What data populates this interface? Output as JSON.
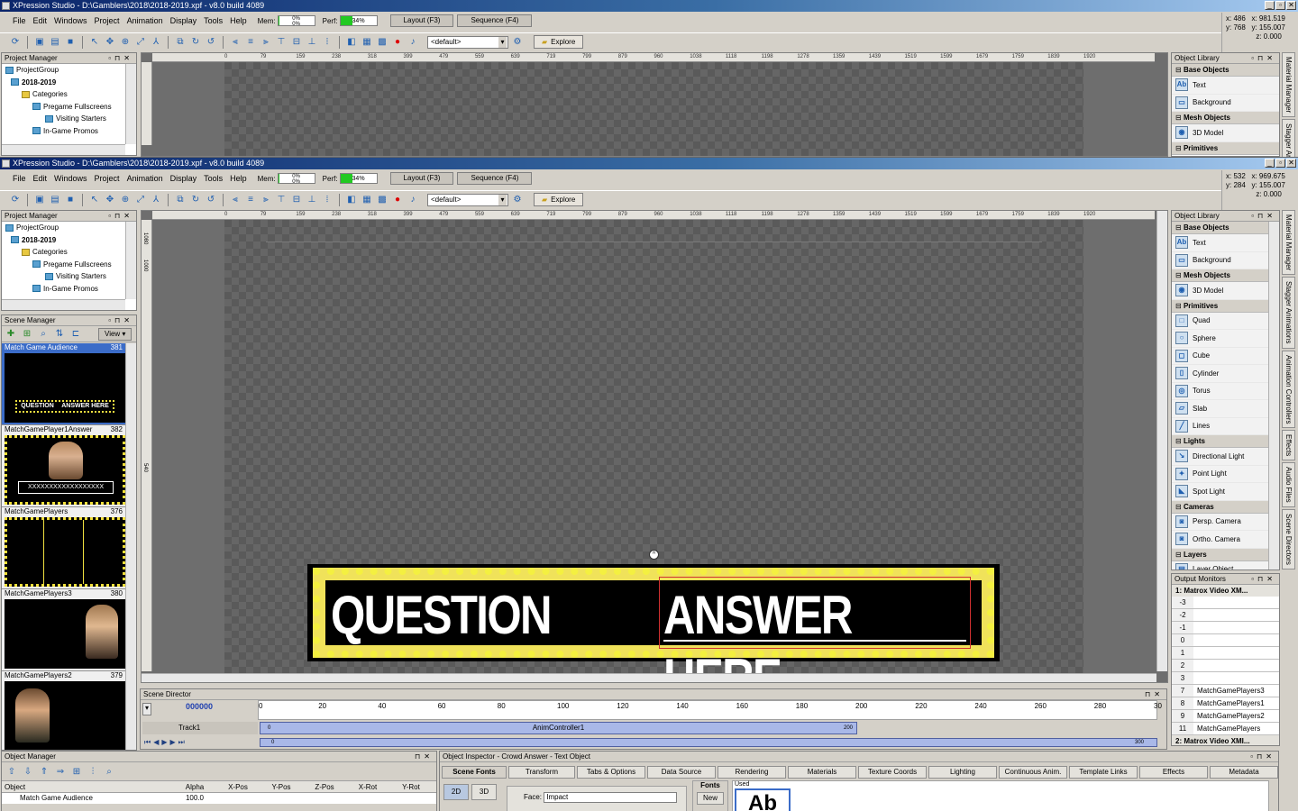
{
  "app": {
    "title": "XPression Studio - D:\\Gamblers\\2018\\2018-2019.xpf - v8.0 build 4089",
    "menu": [
      "File",
      "Edit",
      "Windows",
      "Project",
      "Animation",
      "Display",
      "Tools",
      "Help"
    ],
    "mem_label": "Mem:",
    "mem_values": "0%\n0%",
    "mem_value_a": "0%",
    "mem_value_b": "0%",
    "perf_label": "Perf:",
    "perf_value": "34%",
    "perf_fraction": 0.34,
    "layout_tab": "Layout (F3)",
    "sequence_tab": "Sequence (F4)",
    "layout_combo": "<default>",
    "explore_label": "Explore"
  },
  "window1": {
    "coords": [
      "x: 486",
      "y: 768",
      "x: 981.519",
      "y: 155.007",
      "z: 0.000"
    ]
  },
  "window2": {
    "coords": [
      "x: 532",
      "y: 284",
      "x: 969.675",
      "y: 155.007",
      "z: 0.000"
    ]
  },
  "ruler_ticks": [
    "0",
    "79",
    "159",
    "238",
    "318",
    "399",
    "479",
    "559",
    "639",
    "719",
    "799",
    "879",
    "960",
    "1038",
    "1118",
    "1198",
    "1278",
    "1359",
    "1439",
    "1519",
    "1599",
    "1679",
    "1759",
    "1839",
    "1920"
  ],
  "vruler_ticks": [
    "1080",
    "1000",
    "540"
  ],
  "project_manager": {
    "title": "Project Manager",
    "nodes": [
      "ProjectGroup",
      "2018-2019",
      "Categories",
      "Pregame Fullscreens",
      "Visiting Starters",
      "In-Game Promos"
    ]
  },
  "scene_manager": {
    "title": "Scene Manager",
    "view_label": "View",
    "scenes": [
      {
        "name": "Match Game Audience",
        "id": "381"
      },
      {
        "name": "MatchGamePlayer1Answer",
        "id": "382"
      },
      {
        "name": "MatchGamePlayers",
        "id": "376"
      },
      {
        "name": "MatchGamePlayers3",
        "id": "380"
      },
      {
        "name": "MatchGamePlayers2",
        "id": "379"
      }
    ],
    "thumb_q": "QUESTION",
    "thumb_a": "ANSWER HERE",
    "thumb_x": "XXXXXXXXXXXXXXXXXX"
  },
  "object_library": {
    "title": "Object Library",
    "categories": [
      {
        "name": "Base Objects",
        "items": [
          "Text",
          "Background"
        ]
      },
      {
        "name": "Mesh Objects",
        "items": [
          "3D Model"
        ]
      },
      {
        "name": "Primitives",
        "items": [
          "Quad",
          "Sphere",
          "Cube",
          "Cylinder",
          "Torus",
          "Slab",
          "Lines"
        ]
      },
      {
        "name": "Lights",
        "items": [
          "Directional Light",
          "Point Light",
          "Spot Light"
        ]
      },
      {
        "name": "Cameras",
        "items": [
          "Persp. Camera",
          "Ortho. Camera"
        ]
      },
      {
        "name": "Layers",
        "items": [
          "Layer Object"
        ]
      }
    ]
  },
  "side_tabs": [
    "Material Manager",
    "Stagger Animations",
    "Animation Controllers",
    "Effects",
    "Audio Files",
    "Scene Directors"
  ],
  "canvas_text": {
    "question": "QUESTION",
    "answer": "ANSWER HERE"
  },
  "scene_director": {
    "title": "Scene Director",
    "frame": "000000",
    "ticks": [
      "0",
      "20",
      "40",
      "60",
      "80",
      "100",
      "120",
      "140",
      "160",
      "180",
      "200",
      "220",
      "240",
      "260",
      "280",
      "30"
    ],
    "track": "Track1",
    "controller": "AnimController1",
    "ctrl_start": "0",
    "ctrl_end": "200",
    "range_start": "0",
    "range_end": "300"
  },
  "output_monitors": {
    "title": "Output Monitors",
    "header1": "1: Matrox Video XM...",
    "rows": [
      {
        "n": "-3",
        "name": ""
      },
      {
        "n": "-2",
        "name": ""
      },
      {
        "n": "-1",
        "name": ""
      },
      {
        "n": "0",
        "name": ""
      },
      {
        "n": "1",
        "name": ""
      },
      {
        "n": "2",
        "name": ""
      },
      {
        "n": "3",
        "name": ""
      },
      {
        "n": "7",
        "name": "MatchGamePlayers3"
      },
      {
        "n": "8",
        "name": "MatchGamePlayers1"
      },
      {
        "n": "9",
        "name": "MatchGamePlayers2"
      },
      {
        "n": "11",
        "name": "MatchGamePlayers"
      }
    ],
    "header2": "2: Matrox Video XMI..."
  },
  "object_manager": {
    "title": "Object Manager",
    "columns": [
      "Object",
      "Alpha",
      "X-Pos",
      "Y-Pos",
      "Z-Pos",
      "X-Rot",
      "Y-Rot"
    ],
    "row": {
      "name": "Match Game Audience",
      "alpha": "100.0"
    }
  },
  "object_inspector": {
    "title": "Object Inspector - Crowd Answer - Text Object",
    "tabs": [
      "Scene Fonts",
      "Transform",
      "Tabs & Options",
      "Data Source",
      "Rendering",
      "Materials",
      "Texture Coords",
      "Lighting",
      "Continuous Anim.",
      "Template Links",
      "Effects",
      "Metadata"
    ],
    "btn_2d": "2D",
    "btn_3d": "3D",
    "face_label": "Face:",
    "face_value": "Impact",
    "fonts_label": "Fonts",
    "new_label": "New",
    "used_label": "Used",
    "preview": "Ab"
  }
}
